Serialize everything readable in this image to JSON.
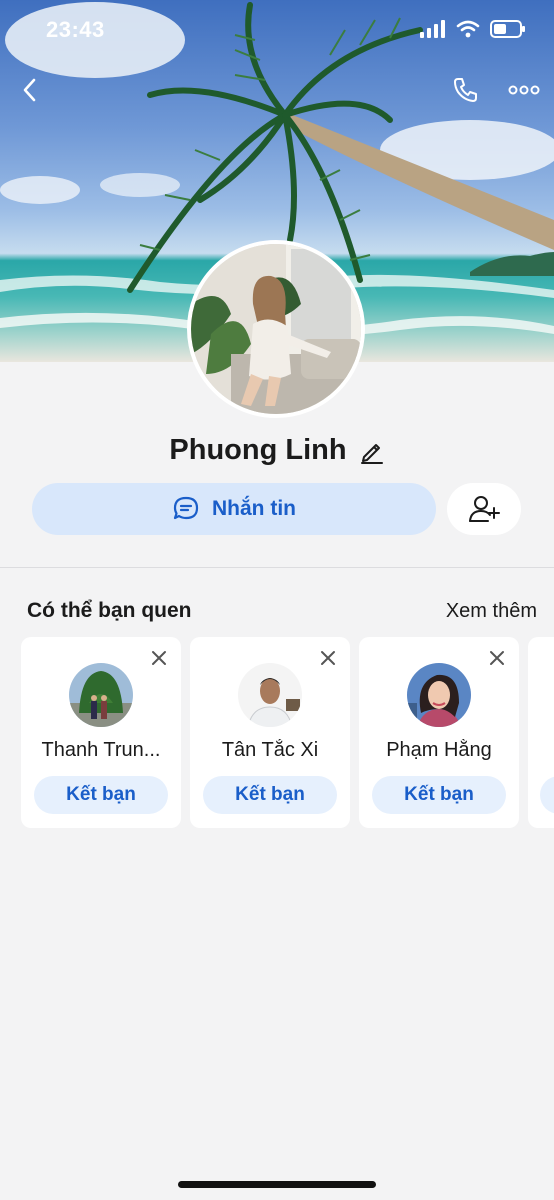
{
  "status_bar": {
    "time": "23:43"
  },
  "profile": {
    "name": "Phuong Linh"
  },
  "actions": {
    "message_label": "Nhắn tin"
  },
  "suggestions": {
    "title": "Có thể bạn quen",
    "see_more": "Xem thêm",
    "items": [
      {
        "name": "Thanh Trun...",
        "button": "Kết bạn"
      },
      {
        "name": "Tân Tắc Xi",
        "button": "Kết bạn"
      },
      {
        "name": "Phạm Hằng",
        "button": "Kết bạn"
      }
    ]
  },
  "colors": {
    "accent": "#1a5ec9",
    "accent_bg": "#d8e7fb",
    "page_bg": "#f3f3f4"
  },
  "icons": [
    "back-icon",
    "phone-icon",
    "more-icon",
    "edit-icon",
    "chat-bubble-icon",
    "add-friend-icon",
    "close-icon"
  ]
}
